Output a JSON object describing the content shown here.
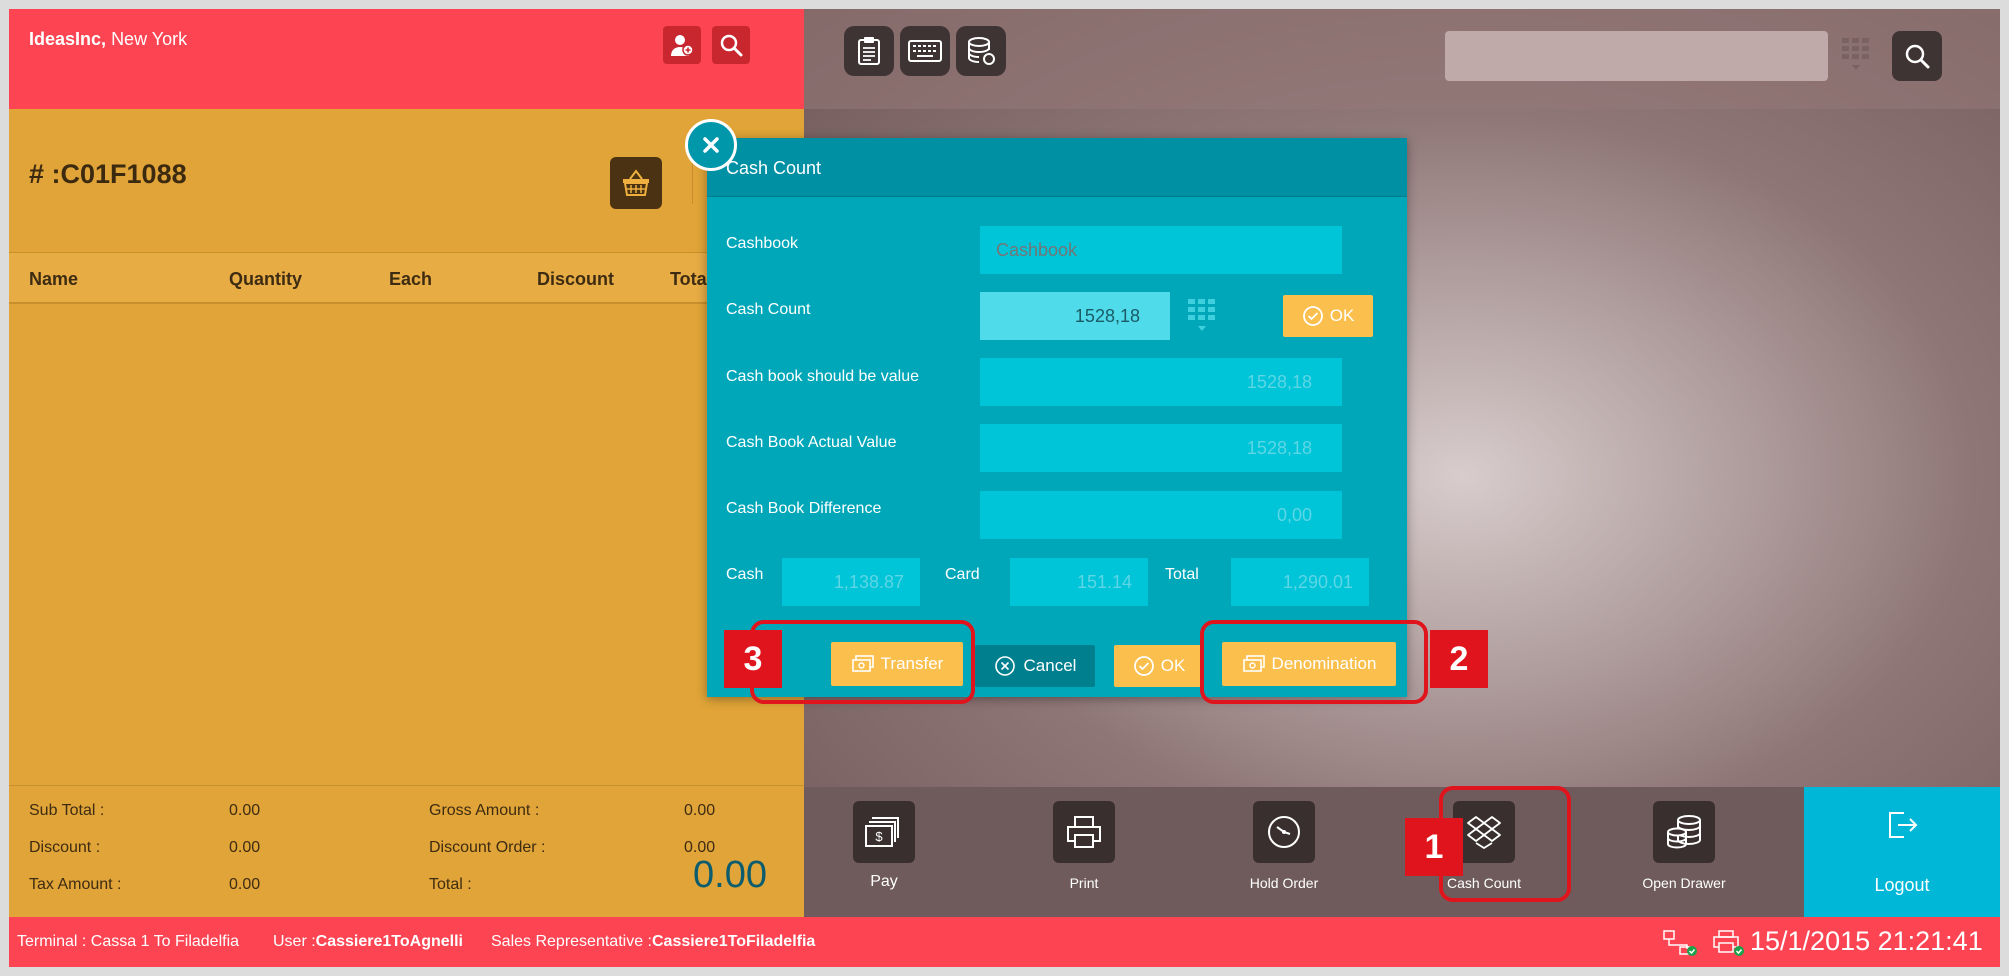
{
  "company": {
    "name": "IdeasInc,",
    "city": "New York"
  },
  "order": {
    "number": "# :C01F1088"
  },
  "columns": [
    "Name",
    "Quantity",
    "Each",
    "Discount",
    "Tota"
  ],
  "totals": {
    "sub_total_label": "Sub Total :",
    "sub_total": "0.00",
    "gross_amount_label": "Gross Amount :",
    "gross_amount": "0.00",
    "discount_label": "Discount :",
    "discount": "0.00",
    "discount_order_label": "Discount Order :",
    "discount_order": "0.00",
    "tax_amount_label": "Tax Amount :",
    "tax_amount": "0.00",
    "total_label": "Total :",
    "grand_total": "0.00"
  },
  "modal": {
    "title": "Cash Count",
    "cashbook_label": "Cashbook",
    "cashbook_placeholder": "Cashbook",
    "cash_count_label": "Cash Count",
    "cash_count_value": "1528,18",
    "ok_label": "OK",
    "should_be_label": "Cash book should be value",
    "should_be_value": "1528,18",
    "actual_label": "Cash Book Actual Value",
    "actual_value": "1528,18",
    "difference_label": "Cash Book Difference",
    "difference_value": "0,00",
    "cash_label": "Cash",
    "cash_value": "1,138.87",
    "card_label": "Card",
    "card_value": "151.14",
    "total_label": "Total",
    "total_value": "1,290.01",
    "transfer_label": "Transfer",
    "cancel_label": "Cancel",
    "denomination_label": "Denomination"
  },
  "bottom_bar": [
    {
      "label": "Pay",
      "icon": "cash-icon"
    },
    {
      "label": "Print",
      "icon": "printer-icon"
    },
    {
      "label": "Hold Order",
      "icon": "clock-icon"
    },
    {
      "label": "Cash Count",
      "icon": "dropbox-icon"
    },
    {
      "label": "Open Drawer",
      "icon": "coins-icon"
    },
    {
      "label": "Logout",
      "icon": "logout-icon"
    }
  ],
  "status": {
    "terminal_label": "Terminal : ",
    "terminal": "Cassa 1 To Filadelfia",
    "user_label": "User :",
    "user": "Cassiere1ToAgnelli",
    "sales_rep_label": "Sales Representative :",
    "sales_rep": "Cassiere1ToFiladelfia",
    "datetime": "15/1/2015 21:21:41"
  },
  "annotations": [
    "1",
    "2",
    "3"
  ],
  "colors": {
    "header_red": "#fc4452",
    "order_yellow": "#e0a438",
    "modal_teal": "#00a7b8",
    "button_yellow": "#fbbf4d",
    "annotation_red": "#e0141c"
  }
}
